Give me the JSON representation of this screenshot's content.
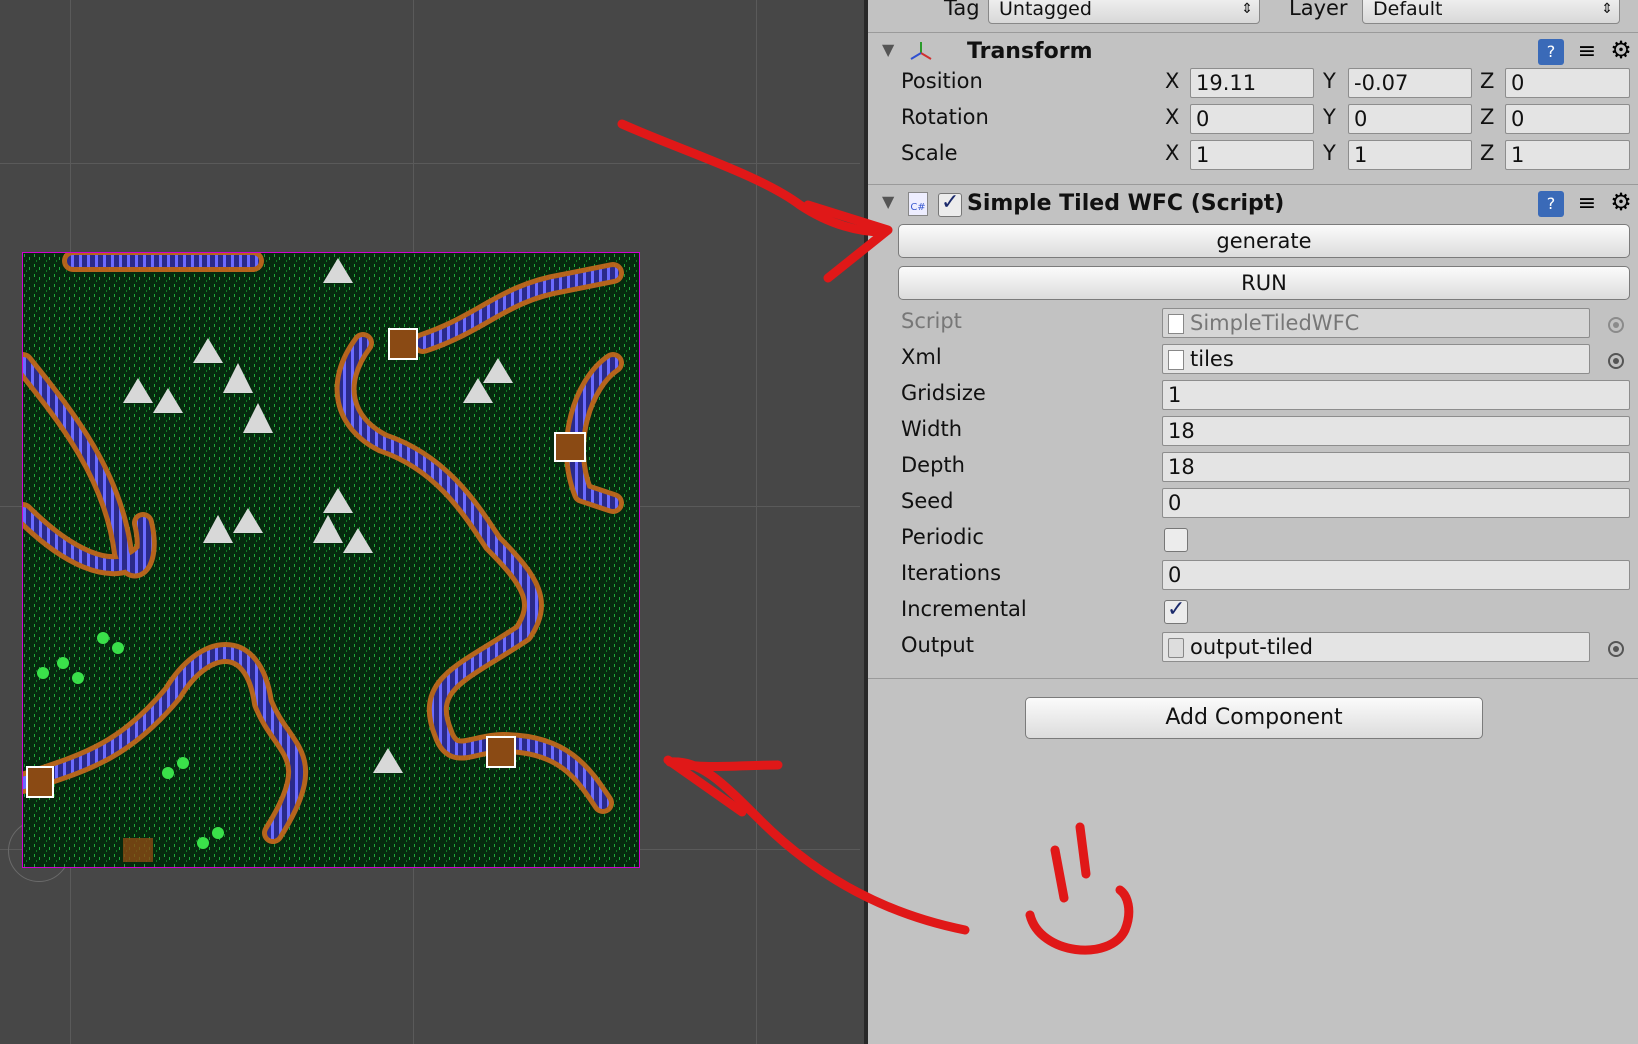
{
  "header": {
    "tag_label": "Tag",
    "tag_value": "Untagged",
    "layer_label": "Layer",
    "layer_value": "Default"
  },
  "transform": {
    "title": "Transform",
    "rows": [
      {
        "label": "Position",
        "x": "19.11",
        "y": "-0.07",
        "z": "0"
      },
      {
        "label": "Rotation",
        "x": "0",
        "y": "0",
        "z": "0"
      },
      {
        "label": "Scale",
        "x": "1",
        "y": "1",
        "z": "1"
      }
    ],
    "axis_x": "X",
    "axis_y": "Y",
    "axis_z": "Z"
  },
  "script_component": {
    "title": "Simple Tiled WFC (Script)",
    "enabled": true,
    "cs_badge": "C#",
    "generate_label": "generate",
    "run_label": "RUN",
    "fields": {
      "script_label": "Script",
      "script_value": "SimpleTiledWFC",
      "xml_label": "Xml",
      "xml_value": "tiles",
      "gridsize_label": "Gridsize",
      "gridsize_value": "1",
      "width_label": "Width",
      "width_value": "18",
      "depth_label": "Depth",
      "depth_value": "18",
      "seed_label": "Seed",
      "seed_value": "0",
      "periodic_label": "Periodic",
      "periodic_checked": false,
      "iterations_label": "Iterations",
      "iterations_value": "0",
      "incremental_label": "Incremental",
      "incremental_checked": true,
      "output_label": "Output",
      "output_value": "output-tiled"
    }
  },
  "add_component_label": "Add Component",
  "colors": {
    "inspector_bg": "#c2c2c2",
    "scene_bg": "#474747",
    "annotation_red": "#e01818",
    "selection_outline": "#d000d0"
  }
}
